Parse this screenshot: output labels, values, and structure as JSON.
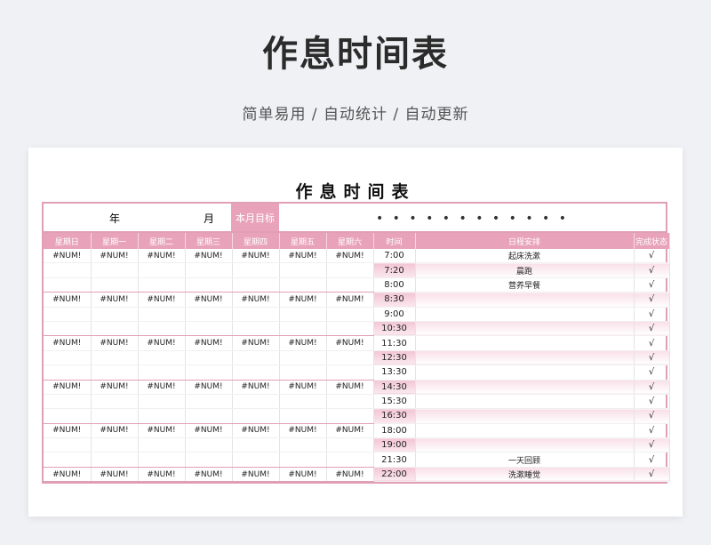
{
  "hero": {
    "title": "作息时间表",
    "subtitle": "简单易用 / 自动统计 / 自动更新"
  },
  "sheet": {
    "title": "作息时间表",
    "year_label": "年",
    "month_label": "月",
    "goal_label": "本月目标",
    "goal_value": "• • • • • • • • • • • •",
    "headers": [
      "星期日",
      "星期一",
      "星期二",
      "星期三",
      "星期四",
      "星期五",
      "星期六",
      "时间",
      "日程安排",
      "完成状态"
    ],
    "weeks": [
      [
        "#NUM!",
        "#NUM!",
        "#NUM!",
        "#NUM!",
        "#NUM!",
        "#NUM!",
        "#NUM!"
      ],
      [
        "#NUM!",
        "#NUM!",
        "#NUM!",
        "#NUM!",
        "#NUM!",
        "#NUM!",
        "#NUM!"
      ],
      [
        "#NUM!",
        "#NUM!",
        "#NUM!",
        "#NUM!",
        "#NUM!",
        "#NUM!",
        "#NUM!"
      ],
      [
        "#NUM!",
        "#NUM!",
        "#NUM!",
        "#NUM!",
        "#NUM!",
        "#NUM!",
        "#NUM!"
      ],
      [
        "#NUM!",
        "#NUM!",
        "#NUM!",
        "#NUM!",
        "#NUM!",
        "#NUM!",
        "#NUM!"
      ],
      [
        "#NUM!",
        "#NUM!",
        "#NUM!",
        "#NUM!",
        "#NUM!",
        "#NUM!",
        "#NUM!"
      ]
    ],
    "schedule": [
      {
        "time": "7:00",
        "task": "起床洗漱",
        "done": "√"
      },
      {
        "time": "7:20",
        "task": "晨跑",
        "done": "√"
      },
      {
        "time": "8:00",
        "task": "营养早餐",
        "done": "√"
      },
      {
        "time": "8:30",
        "task": "",
        "done": "√"
      },
      {
        "time": "9:00",
        "task": "",
        "done": "√"
      },
      {
        "time": "10:30",
        "task": "",
        "done": "√"
      },
      {
        "time": "11:30",
        "task": "",
        "done": "√"
      },
      {
        "time": "12:30",
        "task": "",
        "done": "√"
      },
      {
        "time": "13:30",
        "task": "",
        "done": "√"
      },
      {
        "time": "14:30",
        "task": "",
        "done": "√"
      },
      {
        "time": "15:30",
        "task": "",
        "done": "√"
      },
      {
        "time": "16:30",
        "task": "",
        "done": "√"
      },
      {
        "time": "18:00",
        "task": "",
        "done": "√"
      },
      {
        "time": "19:00",
        "task": "",
        "done": "√"
      },
      {
        "time": "21:30",
        "task": "一天回顾",
        "done": "√"
      },
      {
        "time": "22:00",
        "task": "洗漱睡觉",
        "done": "√"
      }
    ],
    "colors": {
      "accent": "#e8a3bb",
      "border": "#e19fb6"
    }
  }
}
